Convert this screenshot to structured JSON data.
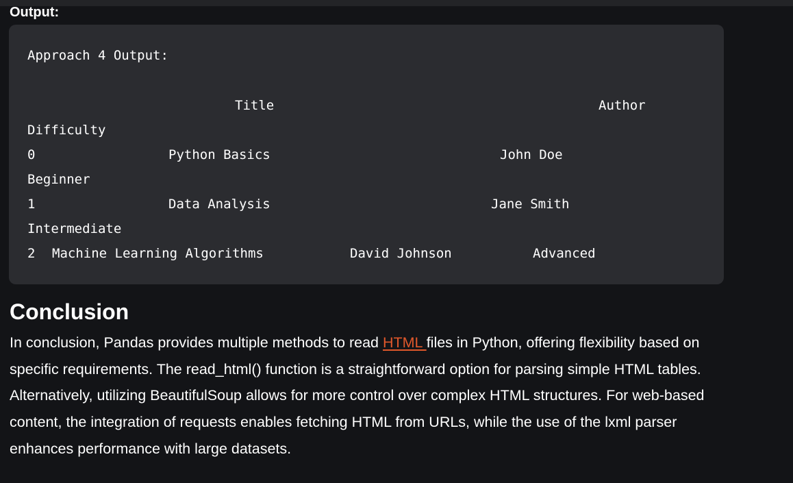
{
  "output_label": "Output:",
  "code_output": {
    "header": "Approach 4 Output:",
    "columns": {
      "title": "Title",
      "author": "Author",
      "difficulty": "Difficulty"
    },
    "rows": [
      {
        "index": "0",
        "title": "Python Basics",
        "author": "John Doe",
        "difficulty": "Beginner"
      },
      {
        "index": "1",
        "title": "Data Analysis",
        "author": "Jane Smith",
        "difficulty": "Intermediate"
      },
      {
        "index": "2",
        "title": "Machine Learning Algorithms",
        "author": "David Johnson",
        "difficulty": "Advanced"
      }
    ]
  },
  "conclusion": {
    "heading": "Conclusion",
    "text_before_link": "In conclusion, Pandas provides multiple methods to read ",
    "link_text": "HTML ",
    "text_after_link": "files in Python, offering flexibility based on specific requirements. The read_html() function is a straightforward option for parsing simple HTML tables. Alternatively, utilizing BeautifulSoup allows for more control over complex HTML structures. For web-based content, the integration of requests enables fetching HTML from URLs, while the use of the lxml parser enhances performance with large datasets."
  },
  "colors": {
    "page_background": "#131417",
    "code_background": "#2b2c30",
    "link": "#e0582b",
    "text": "#ffffff"
  }
}
